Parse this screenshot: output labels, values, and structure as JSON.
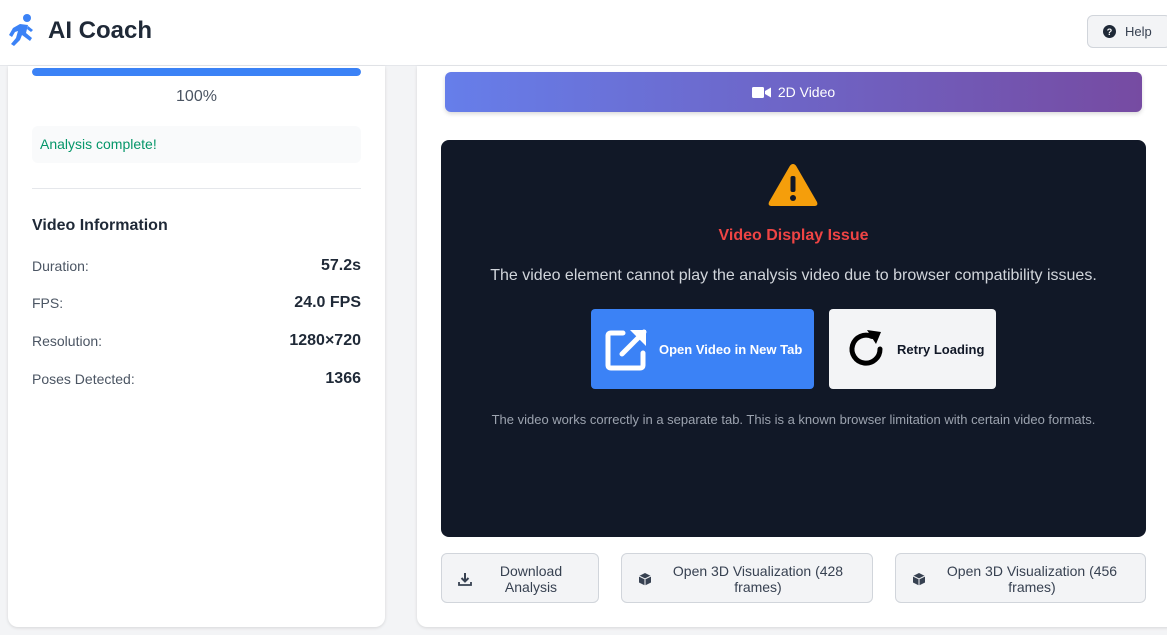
{
  "header": {
    "title": "AI Coach",
    "logo_icon": "running-person-icon",
    "help_label": "Help",
    "help_icon": "question-circle-icon"
  },
  "analysis": {
    "progress_percent": 100,
    "progress_label": "100%",
    "status_message": "Analysis complete!"
  },
  "video_info": {
    "title": "Video Information",
    "rows": [
      {
        "label": "Duration:",
        "value": "57.2s"
      },
      {
        "label": "FPS:",
        "value": "24.0 FPS"
      },
      {
        "label": "Resolution:",
        "value": "1280×720"
      },
      {
        "label": "Poses Detected:",
        "value": "1366"
      }
    ]
  },
  "video_tab": {
    "label": "2D Video",
    "icon": "video-camera-icon"
  },
  "video_error": {
    "icon": "warning-triangle-icon",
    "title": "Video Display Issue",
    "message": "The video element cannot play the analysis video due to browser compatibility issues.",
    "open_button": "Open Video in New Tab",
    "retry_button": "Retry Loading",
    "note": "The video works correctly in a separate tab. This is a known browser limitation with certain video formats."
  },
  "actions": [
    {
      "label": "Download Analysis",
      "icon": "download-icon"
    },
    {
      "label": "Open 3D Visualization (428 frames)",
      "icon": "cube-icon"
    },
    {
      "label": "Open 3D Visualization (456 frames)",
      "icon": "cube-icon"
    }
  ],
  "colors": {
    "accent": "#3b82f6",
    "success": "#059669",
    "error": "#ef4444",
    "warning": "#f59e0b",
    "tab_gradient_start": "#667eea",
    "tab_gradient_end": "#764ba2",
    "video_bg": "#111827"
  }
}
